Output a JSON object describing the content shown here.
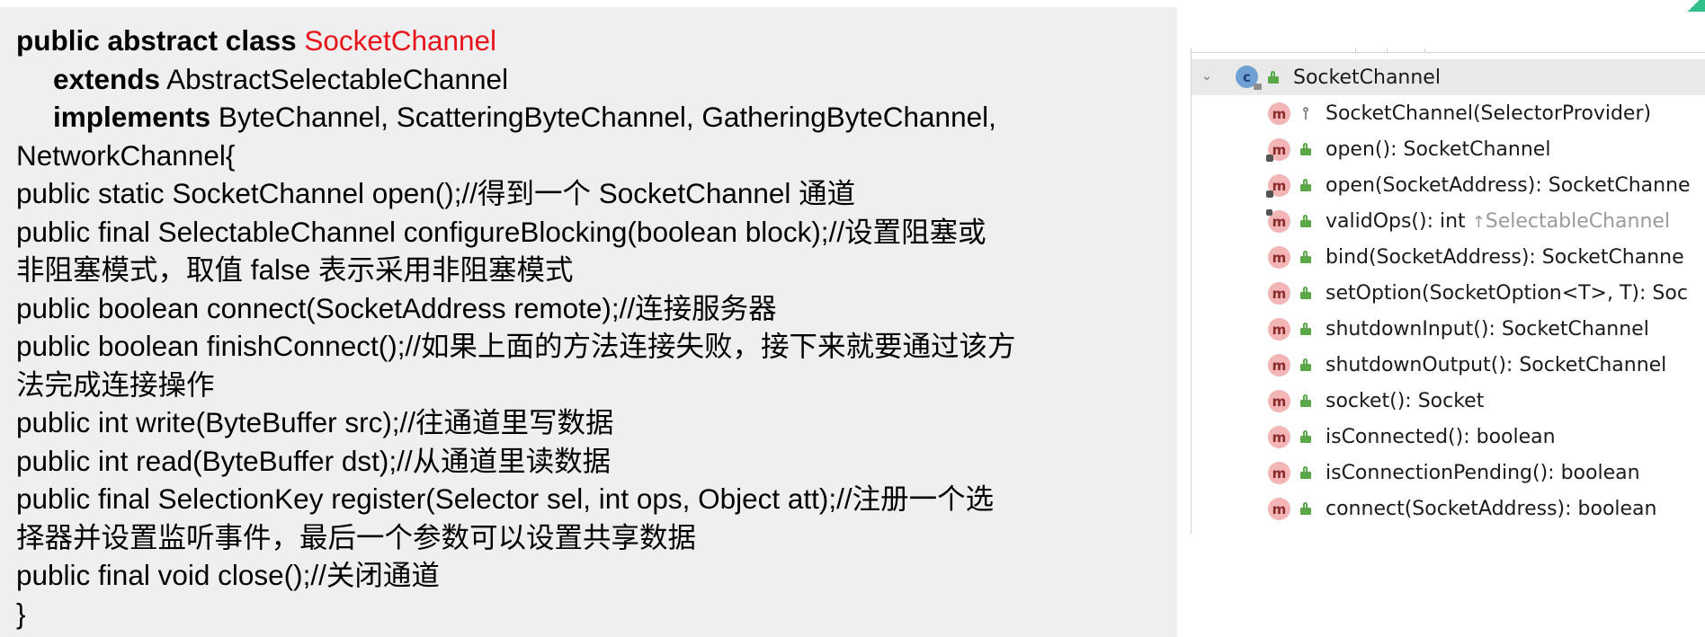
{
  "code": {
    "line1": {
      "kw": "public abstract class",
      "cls": "SocketChannel"
    },
    "line2": {
      "kw": "extends",
      "rest": "AbstractSelectableChannel"
    },
    "line3": {
      "kw": "implements",
      "rest": "ByteChannel, ScatteringByteChannel, GatheringByteChannel,"
    },
    "lines": [
      "NetworkChannel{",
      "public static SocketChannel open();//得到一个 SocketChannel 通道",
      "public final SelectableChannel configureBlocking(boolean block);//设置阻塞或",
      "非阻塞模式，取值 false 表示采用非阻塞模式",
      "public boolean connect(SocketAddress remote);//连接服务器",
      "public boolean finishConnect();//如果上面的方法连接失败，接下来就要通过该方",
      "法完成连接操作",
      "public int write(ByteBuffer src);//往通道里写数据",
      "public int read(ByteBuffer dst);//从通道里读数据",
      "public final SelectionKey register(Selector sel, int ops, Object att);//注册一个选",
      "择器并设置监听事件，最后一个参数可以设置共享数据",
      "public final void close();//关闭通道",
      "}"
    ]
  },
  "structure": {
    "class_icon": "c",
    "class_name": "SocketChannel",
    "method_icon": "m",
    "items": [
      {
        "label": "SocketChannel(SelectorProvider)",
        "visibility": "protected",
        "abstract": false
      },
      {
        "label": "open(): SocketChannel",
        "visibility": "public",
        "abstract": false,
        "static": true
      },
      {
        "label": "open(SocketAddress): SocketChanne",
        "visibility": "public",
        "abstract": false,
        "static": true
      },
      {
        "label": "validOps(): int ",
        "hint_arrow": "↑",
        "hint": "SelectableChannel",
        "visibility": "public",
        "abstract": false,
        "final": true
      },
      {
        "label": "bind(SocketAddress): SocketChanne",
        "visibility": "public",
        "abstract": true
      },
      {
        "label": "setOption(SocketOption<T>, T): Soc",
        "visibility": "public",
        "abstract": true
      },
      {
        "label": "shutdownInput(): SocketChannel",
        "visibility": "public",
        "abstract": true
      },
      {
        "label": "shutdownOutput(): SocketChannel",
        "visibility": "public",
        "abstract": true
      },
      {
        "label": "socket(): Socket",
        "visibility": "public",
        "abstract": true
      },
      {
        "label": "isConnected(): boolean",
        "visibility": "public",
        "abstract": true
      },
      {
        "label": "isConnectionPending(): boolean",
        "visibility": "public",
        "abstract": true
      },
      {
        "label": "connect(SocketAddress): boolean",
        "visibility": "public",
        "abstract": true
      }
    ]
  },
  "colors": {
    "class_name_red": "#e8131a",
    "panel_bg": "#efefef",
    "header_row_bg": "#e9e9e9",
    "method_icon": "#f3b5b5",
    "public_lock": "#5aa84a",
    "accent": "#2fbf8a"
  }
}
